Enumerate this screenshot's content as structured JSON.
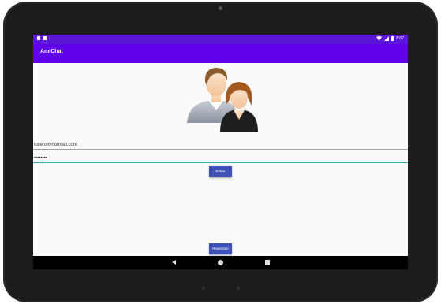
{
  "status_bar": {
    "time": "8:07"
  },
  "app": {
    "title": "AmiChat"
  },
  "login": {
    "email_value": "lucero@hotmail.com",
    "password_value": "••••••••",
    "enter_label": "Entrar",
    "register_label": "Registrate"
  },
  "navigation": {
    "back": "back-icon",
    "home": "home-icon",
    "recents": "recents-icon"
  },
  "colors": {
    "status_bar": "#5b16d6",
    "app_bar": "#6200ee",
    "button": "#3f51b5",
    "focused_underline": "#29b6a8"
  }
}
